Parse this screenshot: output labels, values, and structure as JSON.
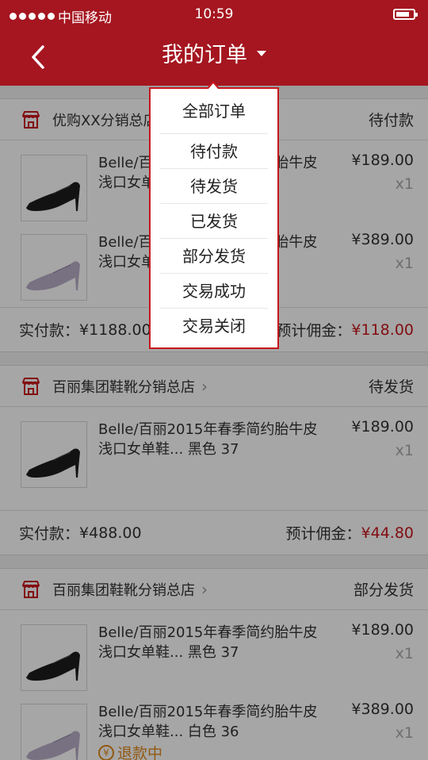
{
  "status_bar": {
    "carrier": "中国移动",
    "time": "10:59"
  },
  "navbar": {
    "title": "我的订单"
  },
  "orders": [
    {
      "shop": "优购XX分销总店",
      "status": "待付款",
      "items": [
        {
          "title": "Belle/百丽2015年春季简约胎牛皮浅口女单鞋... 黑色 37",
          "price": "¥189.00",
          "qty": "x1",
          "color": "black"
        },
        {
          "title": "Belle/百丽2015年春季简约胎牛皮浅口女单鞋... 白色 36",
          "price": "¥389.00",
          "qty": "x1",
          "color": "lilac"
        }
      ],
      "paid_label": "实付款：",
      "paid": "¥1188.00",
      "commission_label": "预计佣金：",
      "commission": "¥118.00"
    },
    {
      "shop": "百丽集团鞋靴分销总店",
      "status": "待发货",
      "items": [
        {
          "title": "Belle/百丽2015年春季简约胎牛皮浅口女单鞋... 黑色 37",
          "price": "¥189.00",
          "qty": "x1",
          "color": "black"
        }
      ],
      "paid_label": "实付款：",
      "paid": "¥488.00",
      "commission_label": "预计佣金：",
      "commission": "¥44.80"
    },
    {
      "shop": "百丽集团鞋靴分销总店",
      "status": "部分发货",
      "items": [
        {
          "title": "Belle/百丽2015年春季简约胎牛皮浅口女单鞋... 黑色 37",
          "price": "¥189.00",
          "qty": "x1",
          "color": "black"
        },
        {
          "title": "Belle/百丽2015年春季简约胎牛皮浅口女单鞋... 白色 36",
          "price": "¥389.00",
          "qty": "x1",
          "color": "lilac",
          "refund": "退款中"
        }
      ]
    }
  ],
  "dropdown": {
    "items": [
      "全部订单",
      "待付款",
      "待发货",
      "已发货",
      "部分发货",
      "交易成功",
      "交易关闭"
    ]
  },
  "colors": {
    "brand_red": "#a51620",
    "accent_red": "#c8161d",
    "refund_orange": "#e08a1e"
  }
}
